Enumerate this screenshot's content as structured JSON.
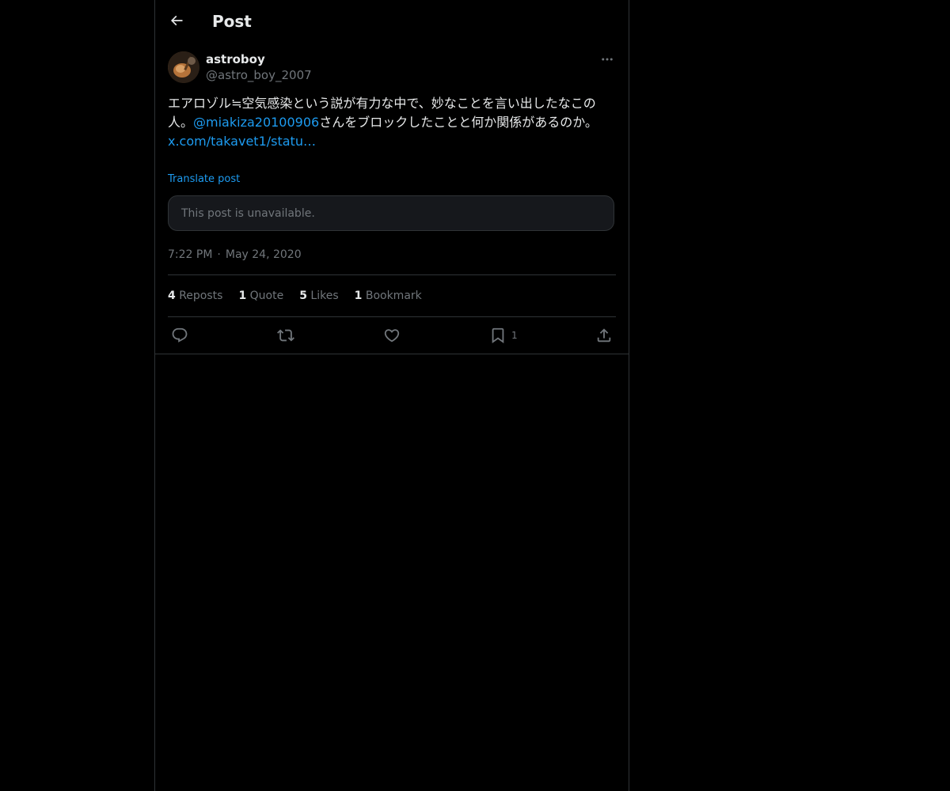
{
  "header": {
    "title": "Post"
  },
  "post": {
    "author_name": "astroboy",
    "author_handle": "@astro_boy_2007",
    "text_part1": "エアロゾル≒空気感染という説が有力な中で、妙なことを言い出したなこの人。",
    "mention": "@miakiza20100906",
    "text_part2": "さんをブロックしたことと何か関係があるのか。",
    "link": "x.com/takavet1/statu…",
    "translate_label": "Translate post",
    "quoted_unavailable": "This post is unavailable.",
    "time": "7:22 PM",
    "date": "May 24, 2020",
    "separator": "·"
  },
  "stats": {
    "reposts_count": "4",
    "reposts_label": "Reposts",
    "quote_count": "1",
    "quote_label": "Quote",
    "likes_count": "5",
    "likes_label": "Likes",
    "bookmark_count": "1",
    "bookmark_label": "Bookmark"
  },
  "actions": {
    "bookmark_count": "1"
  },
  "icons": {
    "back": "arrow-left-icon",
    "more": "more-horizontal-icon",
    "reply": "reply-icon",
    "repost": "repost-icon",
    "like": "heart-icon",
    "bookmark": "bookmark-icon",
    "share": "share-icon"
  },
  "colors": {
    "background": "#000000",
    "accent": "#1d9bf0",
    "text_primary": "#e7e9ea",
    "text_secondary": "#71767b",
    "border": "#2f3336"
  }
}
